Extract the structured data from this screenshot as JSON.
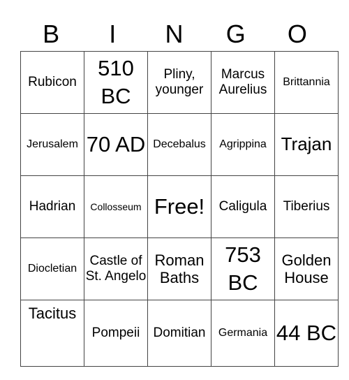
{
  "title_letters": [
    "B",
    "I",
    "N",
    "G",
    "O"
  ],
  "rows": [
    [
      "Rubicon",
      "510 BC",
      "Pliny, younger",
      "Marcus Aurelius",
      "Brittannia"
    ],
    [
      "Jerusalem",
      "70 AD",
      "Decebalus",
      "Agrippina",
      "Trajan"
    ],
    [
      "Hadrian",
      "Collosseum",
      "Free!",
      "Caligula",
      "Tiberius"
    ],
    [
      "Diocletian",
      "Castle of St. Angelo",
      "Roman Baths",
      "753 BC",
      "Golden House"
    ],
    [
      "Tacitus",
      "Pompeii",
      "Domitian",
      "Germania",
      "44 BC"
    ]
  ],
  "colors": {
    "grid_line": "#444444",
    "text": "#000000",
    "background": "#ffffff"
  }
}
